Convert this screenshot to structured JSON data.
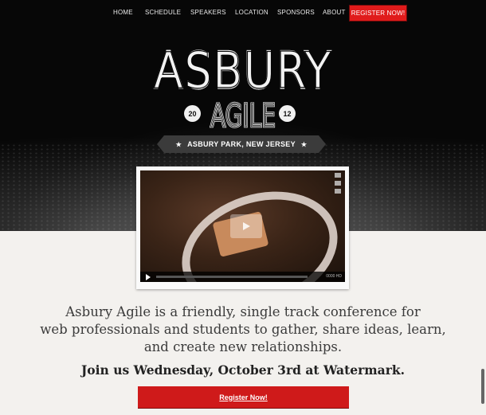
{
  "nav": {
    "items": [
      "HOME",
      "SCHEDULE",
      "SPEAKERS",
      "LOCATION",
      "SPONSORS",
      "ABOUT"
    ],
    "register_label": "REGISTER NOW!"
  },
  "logo": {
    "title": "ASBURY",
    "subtitle": "AGILE",
    "year_left": "20",
    "year_right": "12",
    "location": "ASBURY PARK, NEW JERSEY",
    "star": "★"
  },
  "video": {
    "time": "0000 HD"
  },
  "content": {
    "description_line1": "Asbury Agile is a friendly, single track conference for",
    "description_line2": "web professionals and students to gather, share ideas, learn,",
    "description_line3": "and create new relationships.",
    "cta_text": "Join us Wednesday, October 3rd at Watermark.",
    "register_button": "Register Now!"
  },
  "colors": {
    "accent": "#e01b1b",
    "hero_bg": "#070707",
    "page_bg": "#f3f1ee"
  }
}
